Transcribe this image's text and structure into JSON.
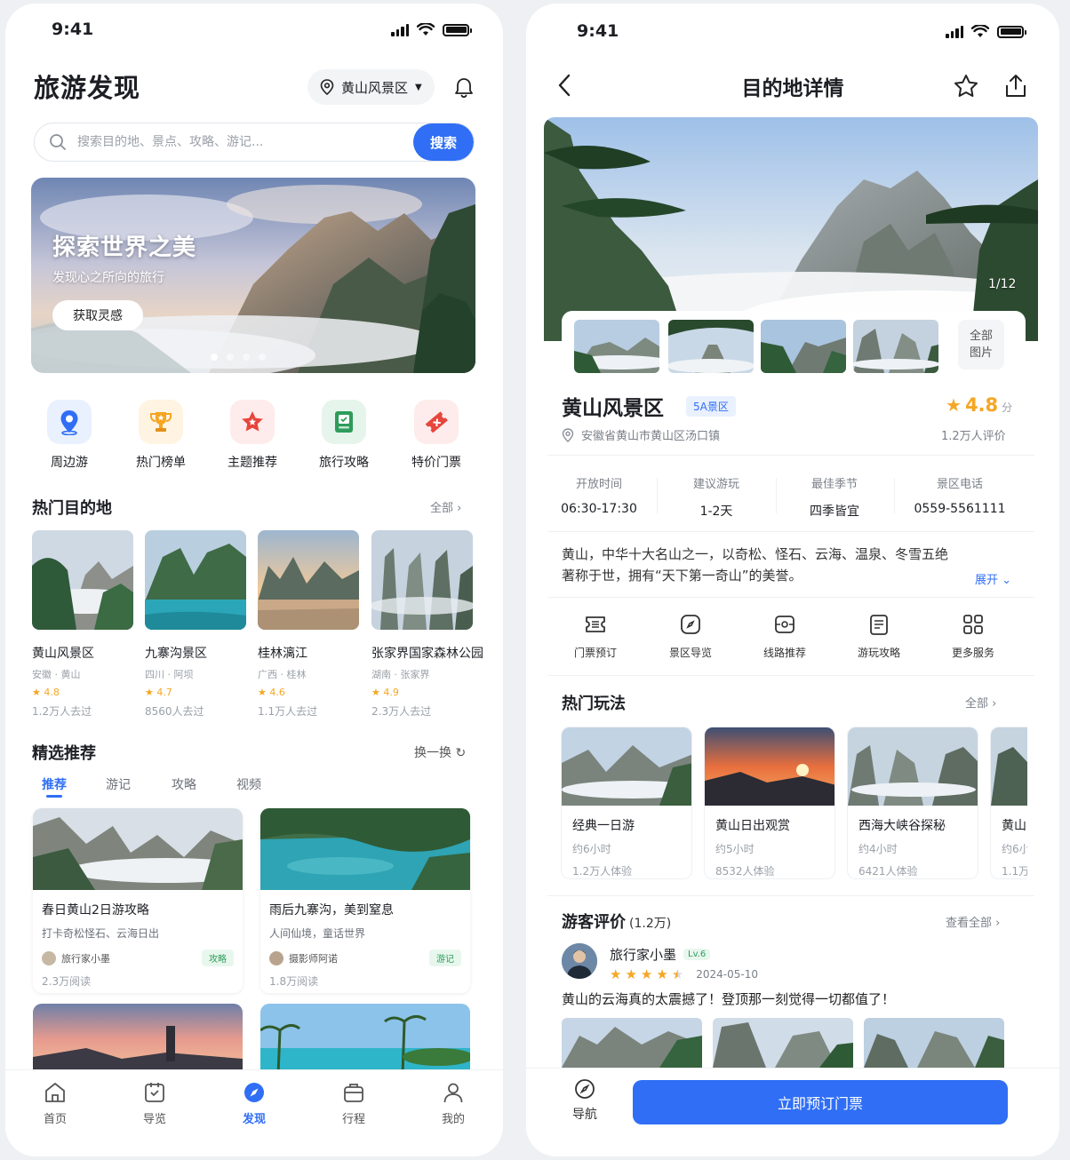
{
  "status_time": "9:41",
  "discover": {
    "title": "旅游发现",
    "location": "黄山风景区",
    "search": {
      "placeholder": "搜索目的地、景点、攻略、游记...",
      "button": "搜索"
    },
    "banner": {
      "title": "探索世界之美",
      "subtitle": "发现心之所向的旅行",
      "button": "获取灵感",
      "dots": 4,
      "active_dot": 0
    },
    "quick": [
      {
        "label": "周边游",
        "icon": "location-pin-icon",
        "color": "#2f6ef5"
      },
      {
        "label": "热门榜单",
        "icon": "trophy-icon",
        "color": "#f5a623"
      },
      {
        "label": "主题推荐",
        "icon": "star-icon",
        "color": "#e8453c"
      },
      {
        "label": "旅行攻略",
        "icon": "guide-book-icon",
        "color": "#2e9c5a"
      },
      {
        "label": "特价门票",
        "icon": "ticket-icon",
        "color": "#e8453c"
      }
    ],
    "hot": {
      "title": "热门目的地",
      "more": "全部",
      "items": [
        {
          "name": "黄山风景区",
          "region": "安徽 · 黄山",
          "rating": "4.8",
          "visits": "1.2万人去过"
        },
        {
          "name": "九寨沟景区",
          "region": "四川 · 阿坝",
          "rating": "4.7",
          "visits": "8560人去过"
        },
        {
          "name": "桂林漓江",
          "region": "广西 · 桂林",
          "rating": "4.6",
          "visits": "1.1万人去过"
        },
        {
          "name": "张家界国家森林公园",
          "region": "湖南 · 张家界",
          "rating": "4.9",
          "visits": "2.3万人去过"
        }
      ]
    },
    "featured": {
      "title": "精选推荐",
      "refresh": "换一换",
      "tabs": [
        "推荐",
        "游记",
        "攻略",
        "视频"
      ],
      "active_tab": 0,
      "items": [
        {
          "title": "春日黄山2日游攻略",
          "subtitle": "打卡奇松怪石、云海日出",
          "author": "旅行家小墨",
          "tag": "攻略",
          "reads": "2.3万阅读"
        },
        {
          "title": "雨后九寨沟，美到窒息",
          "subtitle": "人间仙境，童话世界",
          "author": "摄影师阿诺",
          "tag": "游记",
          "reads": "1.8万阅读"
        }
      ]
    },
    "tabbar": [
      "首页",
      "导览",
      "发现",
      "行程",
      "我的"
    ],
    "tabbar_active": 2
  },
  "detail": {
    "title": "目的地详情",
    "photo_counter": "1/12",
    "all_photos": "全部\n图片",
    "name": "黄山风景区",
    "badge": "5A景区",
    "rating": "4.8",
    "rating_unit": "分",
    "reviews_count": "1.2万人评价",
    "address": "安徽省黄山市黄山区汤口镇",
    "info": [
      {
        "k": "开放时间",
        "v": "06:30-17:30"
      },
      {
        "k": "建议游玩",
        "v": "1-2天"
      },
      {
        "k": "最佳季节",
        "v": "四季皆宜"
      },
      {
        "k": "景区电话",
        "v": "0559-5561111"
      }
    ],
    "desc_line1": "黄山，中华十大名山之一，以奇松、怪石、云海、温泉、冬雪五绝",
    "desc_line2": "著称于世，拥有“天下第一奇山”的美誉。",
    "expand": "展开",
    "services": [
      {
        "label": "门票预订",
        "icon": "ticket-icon"
      },
      {
        "label": "景区导览",
        "icon": "compass-icon"
      },
      {
        "label": "线路推荐",
        "icon": "route-icon"
      },
      {
        "label": "游玩攻略",
        "icon": "document-icon"
      },
      {
        "label": "更多服务",
        "icon": "grid-icon"
      }
    ],
    "plays": {
      "title": "热门玩法",
      "more": "全部",
      "items": [
        {
          "name": "经典一日游",
          "time": "约6小时",
          "count": "1.2万人体验"
        },
        {
          "name": "黄山日出观赏",
          "time": "约5小时",
          "count": "8532人体验"
        },
        {
          "name": "西海大峡谷探秘",
          "time": "约4小时",
          "count": "6421人体验"
        },
        {
          "name": "黄山",
          "time": "约6小",
          "count": "1.1万"
        }
      ]
    },
    "reviews": {
      "title": "游客评价",
      "count": "(1.2万)",
      "more": "查看全部",
      "user": "旅行家小墨",
      "level": "Lv.6",
      "stars": 4.5,
      "date": "2024-05-10",
      "text": "黄山的云海真的太震撼了！登顶那一刻觉得一切都值了！"
    },
    "nav_label": "导航",
    "book_button": "立即预订门票"
  }
}
